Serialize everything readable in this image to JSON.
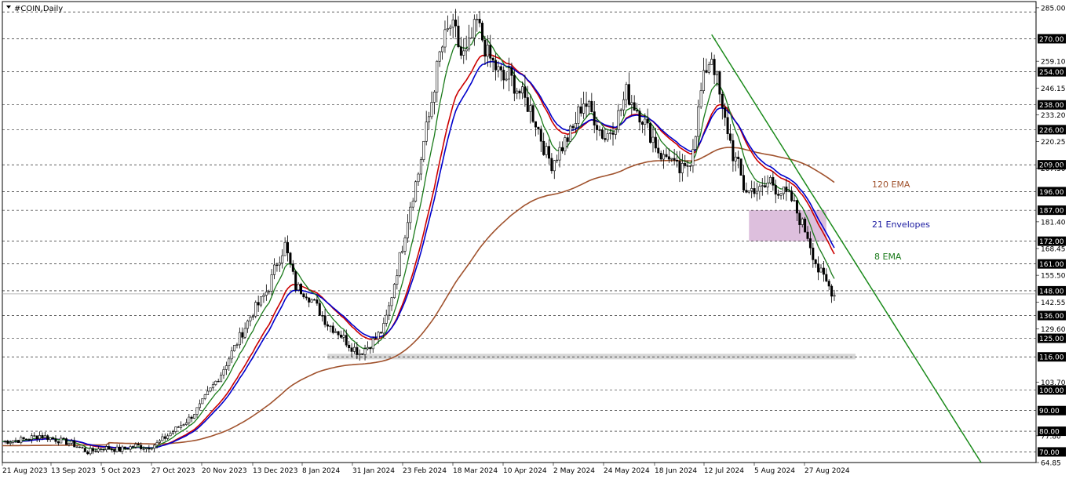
{
  "window": {
    "title": "#COIN,Daily"
  },
  "chart_data": {
    "type": "candlestick",
    "ylim": [
      64.85,
      288.0
    ],
    "price_labels": [
      "285.00",
      "270.00",
      "259.10",
      "254.00",
      "246.15",
      "238.00",
      "233.20",
      "226.00",
      "220.25",
      "209.00",
      "207.30",
      "196.00",
      "187.00",
      "181.40",
      "172.00",
      "168.45",
      "161.00",
      "155.50",
      "148.00",
      "142.55",
      "136.00",
      "129.60",
      "125.00",
      "116.00",
      "103.70",
      "100.00",
      "90.00",
      "77.80",
      "80.00",
      "70.00",
      "64.85"
    ],
    "dashed_levels": [
      283.0,
      270.0,
      254.0,
      238.0,
      226.0,
      209.0,
      196.0,
      187.0,
      172.0,
      161.0,
      148.0,
      136.0,
      125.0,
      116.0,
      100.0,
      90.0,
      80.0,
      70.0
    ],
    "highlight_levels": [
      "283.00",
      "270.00",
      "254.00",
      "238.00",
      "226.00",
      "209.00",
      "196.00",
      "187.00",
      "172.00",
      "161.00",
      "148.00",
      "136.00",
      "125.00",
      "116.00",
      "100.00",
      "90.00",
      "80.00",
      "70.00"
    ],
    "x_labels": [
      "21 Aug 2023",
      "13 Sep 2023",
      "5 Oct 2023",
      "27 Oct 2023",
      "20 Nov 2023",
      "13 Dec 2023",
      "8 Jan 2024",
      "31 Jan 2024",
      "23 Feb 2024",
      "18 Mar 2024",
      "10 Apr 2024",
      "2 May 2024",
      "24 May 2024",
      "18 Jun 2024",
      "12 Jul 2024",
      "5 Aug 2024",
      "27 Aug 2024"
    ],
    "annotations": [
      {
        "text": "120 EMA",
        "color": "#a0522d"
      },
      {
        "text": "21 Envelopes",
        "color": "#1a1aa0"
      },
      {
        "text": "8 EMA",
        "color": "#1a7a1a"
      }
    ],
    "close_path": [
      [
        0,
        75
      ],
      [
        8,
        76
      ],
      [
        14,
        78
      ],
      [
        20,
        76
      ],
      [
        26,
        74
      ],
      [
        32,
        70
      ],
      [
        38,
        72
      ],
      [
        44,
        71
      ],
      [
        50,
        73
      ],
      [
        54,
        72
      ],
      [
        58,
        74
      ],
      [
        62,
        78
      ],
      [
        66,
        82
      ],
      [
        70,
        86
      ],
      [
        74,
        92
      ],
      [
        78,
        100
      ],
      [
        82,
        108
      ],
      [
        86,
        118
      ],
      [
        90,
        128
      ],
      [
        94,
        138
      ],
      [
        97,
        143
      ],
      [
        100,
        150
      ],
      [
        103,
        162
      ],
      [
        106,
        170
      ],
      [
        108,
        160
      ],
      [
        110,
        150
      ],
      [
        114,
        147
      ],
      [
        118,
        140
      ],
      [
        122,
        132
      ],
      [
        126,
        128
      ],
      [
        130,
        122
      ],
      [
        134,
        118
      ],
      [
        137,
        121
      ],
      [
        140,
        125
      ],
      [
        143,
        130
      ],
      [
        145,
        140
      ],
      [
        147,
        152
      ],
      [
        150,
        170
      ],
      [
        153,
        190
      ],
      [
        156,
        205
      ],
      [
        158,
        220
      ],
      [
        160,
        232
      ],
      [
        162,
        248
      ],
      [
        164,
        262
      ],
      [
        166,
        270
      ],
      [
        168,
        276
      ],
      [
        170,
        272
      ],
      [
        172,
        262
      ],
      [
        174,
        262
      ],
      [
        176,
        270
      ],
      [
        178,
        278
      ],
      [
        180,
        270
      ],
      [
        182,
        262
      ],
      [
        184,
        258
      ],
      [
        186,
        254
      ],
      [
        188,
        250
      ],
      [
        190,
        252
      ],
      [
        192,
        248
      ],
      [
        194,
        244
      ],
      [
        196,
        240
      ],
      [
        198,
        236
      ],
      [
        200,
        230
      ],
      [
        202,
        222
      ],
      [
        204,
        214
      ],
      [
        206,
        210
      ],
      [
        208,
        214
      ],
      [
        210,
        218
      ],
      [
        212,
        222
      ],
      [
        214,
        226
      ],
      [
        216,
        234
      ],
      [
        218,
        240
      ],
      [
        220,
        236
      ],
      [
        222,
        232
      ],
      [
        224,
        226
      ],
      [
        226,
        222
      ],
      [
        228,
        226
      ],
      [
        230,
        230
      ],
      [
        232,
        236
      ],
      [
        234,
        244
      ],
      [
        236,
        240
      ],
      [
        238,
        236
      ],
      [
        240,
        232
      ],
      [
        242,
        226
      ],
      [
        244,
        222
      ],
      [
        246,
        216
      ],
      [
        248,
        212
      ],
      [
        250,
        214
      ],
      [
        252,
        208
      ],
      [
        254,
        206
      ],
      [
        256,
        206
      ],
      [
        258,
        212
      ],
      [
        260,
        226
      ],
      [
        262,
        244
      ],
      [
        264,
        256
      ],
      [
        266,
        262
      ],
      [
        268,
        250
      ],
      [
        270,
        234
      ],
      [
        272,
        226
      ],
      [
        274,
        214
      ],
      [
        276,
        208
      ],
      [
        278,
        198
      ],
      [
        280,
        196
      ],
      [
        282,
        198
      ],
      [
        284,
        196
      ],
      [
        286,
        198
      ],
      [
        288,
        202
      ],
      [
        290,
        198
      ],
      [
        292,
        196
      ],
      [
        294,
        194
      ],
      [
        296,
        192
      ],
      [
        298,
        186
      ],
      [
        300,
        180
      ],
      [
        302,
        175
      ],
      [
        304,
        166
      ],
      [
        306,
        158
      ],
      [
        308,
        154
      ],
      [
        310,
        150
      ],
      [
        312,
        146
      ]
    ],
    "indicators": {
      "ema8_color": "#1a7a1a",
      "ema21_color": "#0000cc",
      "ema_red_color": "#cc0000",
      "ema120_color": "#a0522d",
      "trendline_color": "#1a8a1a"
    },
    "zones": [
      {
        "name": "gray-zone",
        "y_from": 114.8,
        "y_to": 117.5,
        "color": "#d8d8d8"
      },
      {
        "name": "pink-zone",
        "y_from": 172.0,
        "y_to": 187.0,
        "color": "#d9b8d9"
      }
    ]
  }
}
